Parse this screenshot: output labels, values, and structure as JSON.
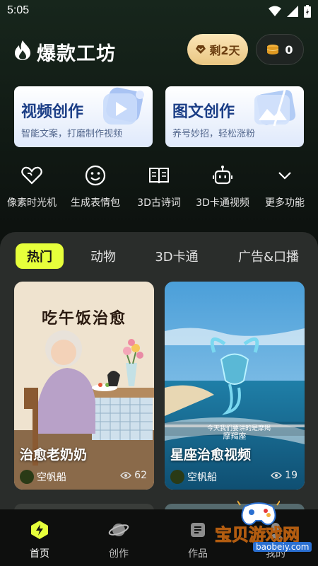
{
  "status": {
    "time": "5:05"
  },
  "header": {
    "title": "爆款工坊",
    "vip_label": "剩2天",
    "coins": "0"
  },
  "cards": [
    {
      "title": "视频创作",
      "subtitle": "智能文案，打磨制作视频"
    },
    {
      "title": "图文创作",
      "subtitle": "养号妙招，轻松涨粉"
    }
  ],
  "shortcuts": [
    {
      "label": "像素时光机",
      "icon": "heart-pixel-icon"
    },
    {
      "label": "生成表情包",
      "icon": "smiley-icon"
    },
    {
      "label": "3D古诗词",
      "icon": "book-icon"
    },
    {
      "label": "3D卡通视频",
      "icon": "robot-icon"
    },
    {
      "label": "更多功能",
      "icon": "chevron-down-icon"
    }
  ],
  "tabs": [
    "热门",
    "动物",
    "3D卡通",
    "广告&口播"
  ],
  "videos": [
    {
      "title": "治愈老奶奶",
      "author": "空帆船",
      "views": "62",
      "thumb_text": "吃午饭治愈"
    },
    {
      "title": "星座治愈视频",
      "author": "空帆船",
      "views": "19",
      "thumb_text": "摩羯座",
      "thumb_caption": "今天我们要讲的是摩羯"
    }
  ],
  "nav": [
    {
      "label": "首页",
      "icon": "lightning-home-icon"
    },
    {
      "label": "创作",
      "icon": "planet-icon"
    },
    {
      "label": "作品",
      "icon": "works-icon"
    },
    {
      "label": "我的",
      "icon": "profile-icon"
    }
  ],
  "watermark": {
    "text": "宝贝游戏网",
    "url": "baobeiy.com"
  },
  "colors": {
    "accent": "#e6ff3b",
    "card_title": "#1b3e86",
    "vip_bg": "#f2d79e"
  }
}
